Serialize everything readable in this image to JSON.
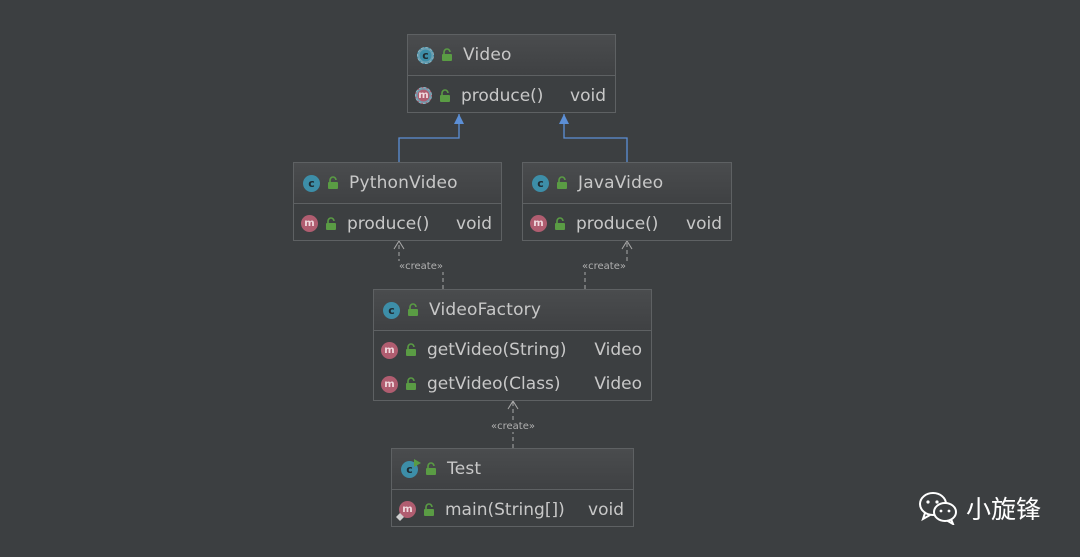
{
  "classes": {
    "video": {
      "icon": "abstract-class-icon",
      "name": "Video",
      "methods": [
        {
          "signature": "produce()",
          "type": "void",
          "icon": "abstract-method-icon"
        }
      ]
    },
    "python_video": {
      "icon": "class-icon",
      "name": "PythonVideo",
      "methods": [
        {
          "signature": "produce()",
          "type": "void",
          "icon": "method-icon"
        }
      ]
    },
    "java_video": {
      "icon": "class-icon",
      "name": "JavaVideo",
      "methods": [
        {
          "signature": "produce()",
          "type": "void",
          "icon": "method-icon"
        }
      ]
    },
    "video_factory": {
      "icon": "class-icon",
      "name": "VideoFactory",
      "methods": [
        {
          "signature": "getVideo(String)",
          "type": "Video",
          "icon": "method-icon"
        },
        {
          "signature": "getVideo(Class)",
          "type": "Video",
          "icon": "method-icon"
        }
      ]
    },
    "test": {
      "icon": "runnable-class-icon",
      "name": "Test",
      "methods": [
        {
          "signature": "main(String[])",
          "type": "void",
          "icon": "static-method-icon"
        }
      ]
    }
  },
  "relations": {
    "factory_creates_python": "«create»",
    "factory_creates_java": "«create»",
    "test_creates_factory": "«create»"
  },
  "icon_letters": {
    "class": "c",
    "method": "m"
  },
  "colors": {
    "background": "#3c3f41",
    "inheritance_arrow": "#5c8fd6",
    "dependency_arrow": "#a9a9a9",
    "class_icon": "#3d8ea8",
    "method_icon": "#b05d70",
    "public_lock": "#5a9c44"
  },
  "watermark": {
    "icon": "wechat-icon",
    "text": "小旋锋"
  }
}
